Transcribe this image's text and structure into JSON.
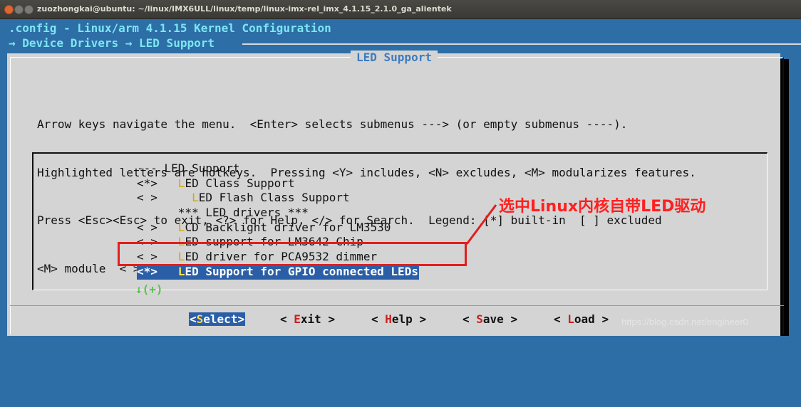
{
  "window": {
    "title": "zuozhongkai@ubuntu: ~/linux/IMX6ULL/linux/temp/linux-imx-rel_imx_4.1.15_2.1.0_ga_alientek"
  },
  "terminal": {
    "config_title": ".config - Linux/arm 4.1.15 Kernel Configuration",
    "breadcrumb": "→ Device Drivers → LED Support"
  },
  "dialog": {
    "title": "LED Support",
    "help_lines": [
      "Arrow keys navigate the menu.  <Enter> selects submenus ---> (or empty submenus ----).",
      "Highlighted letters are hotkeys.  Pressing <Y> includes, <N> excludes, <M> modularizes features.",
      "Press <Esc><Esc> to exit, <?> for Help, </> for Search.  Legend: [*] built-in  [ ] excluded",
      "<M> module  < > module capable"
    ],
    "menu_items": [
      {
        "prefix": "--- ",
        "hotkey": "",
        "rest": "LED Support"
      },
      {
        "prefix": "<*>   ",
        "hotkey": "L",
        "rest": "ED Class Support"
      },
      {
        "prefix": "< >     ",
        "hotkey": "L",
        "rest": "ED Flash Class Support"
      },
      {
        "prefix": "      ",
        "hotkey": "",
        "rest": "*** LED drivers ***"
      },
      {
        "prefix": "< >   ",
        "hotkey": "L",
        "rest": "CD Backlight driver for LM3530"
      },
      {
        "prefix": "< >   ",
        "hotkey": "L",
        "rest": "ED support for LM3642 Chip"
      },
      {
        "prefix": "< >   ",
        "hotkey": "L",
        "rest": "ED driver for PCA9532 dimmer"
      },
      {
        "prefix": "<*>   ",
        "hotkey": "L",
        "rest": "ED Support for GPIO connected LEDs"
      }
    ],
    "more_indicator": "↓(+)",
    "buttons": [
      {
        "pre": "<",
        "hotkey": "S",
        "post": "elect>"
      },
      {
        "pre": "< ",
        "hotkey": "E",
        "post": "xit >"
      },
      {
        "pre": "< ",
        "hotkey": "H",
        "post": "elp >"
      },
      {
        "pre": "< ",
        "hotkey": "S",
        "post": "ave >"
      },
      {
        "pre": "< ",
        "hotkey": "L",
        "post": "oad >"
      }
    ]
  },
  "annotation": {
    "callout": "选中Linux内核自带LED驱动",
    "color": "#e01e1e"
  },
  "watermark": "https://blog.csdn.net/engineer0"
}
